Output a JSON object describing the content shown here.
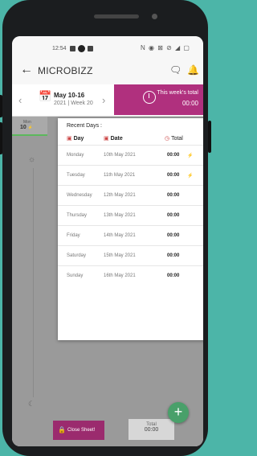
{
  "status_bar": {
    "time": "12:54",
    "right_icons": "N ◉ ⊠ ⊘ ◢ ▢"
  },
  "app": {
    "title": "MICROBIZZ",
    "back_icon": "arrow-left-icon",
    "chat_icon": "chat-icon",
    "bell_icon": "bell-icon"
  },
  "week": {
    "range": "May 10-16",
    "sub": "2021 | Week 20",
    "prev": "‹",
    "next": "›",
    "total_label": "This week's total",
    "total_value": "00:00"
  },
  "calendar": {
    "day_abbr": "Mon",
    "date": "10",
    "date_suffix": "⚡"
  },
  "recent": {
    "title": "Recent Days :",
    "headers": {
      "day": "Day",
      "date": "Date",
      "total": "Total"
    },
    "rows": [
      {
        "day": "Monday",
        "date": "10th May 2021",
        "total": "00:00",
        "flag": "⚡"
      },
      {
        "day": "Tuesday",
        "date": "11th May 2021",
        "total": "00:00",
        "flag": "⚡"
      },
      {
        "day": "Wednesday",
        "date": "12th May 2021",
        "total": "00:00",
        "flag": ""
      },
      {
        "day": "Thursday",
        "date": "13th May 2021",
        "total": "00:00",
        "flag": ""
      },
      {
        "day": "Friday",
        "date": "14th May 2021",
        "total": "00:00",
        "flag": ""
      },
      {
        "day": "Saturday",
        "date": "15th May 2021",
        "total": "00:00",
        "flag": ""
      },
      {
        "day": "Sunday",
        "date": "16th May 2021",
        "total": "00:00",
        "flag": ""
      }
    ]
  },
  "footer": {
    "close_label": "Close Sheet!",
    "total_label": "Total",
    "total_value": "00:00",
    "fab_label": "+"
  },
  "colors": {
    "accent": "#b0307e",
    "fab": "#49a06a",
    "frame": "#4cb5a8"
  }
}
